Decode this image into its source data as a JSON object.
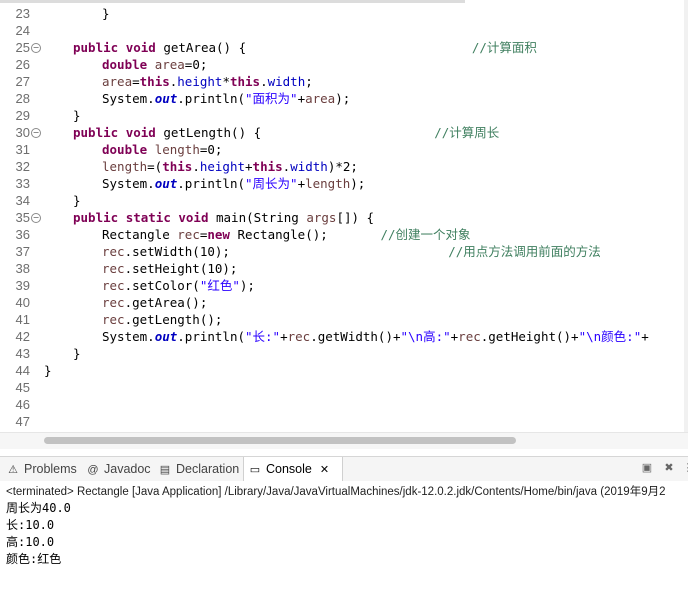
{
  "editor": {
    "lines": [
      {
        "n": "23",
        "fold": false,
        "indent": 2,
        "tokens": [
          [
            "",
            "}"
          ]
        ]
      },
      {
        "n": "24",
        "fold": false,
        "indent": 0,
        "tokens": []
      },
      {
        "n": "25",
        "fold": true,
        "indent": 1,
        "tokens": [
          [
            "kw",
            "public"
          ],
          [
            "",
            " "
          ],
          [
            "kw",
            "void"
          ],
          [
            "",
            " getArea() {                              "
          ],
          [
            "cm",
            "//计算面积"
          ]
        ]
      },
      {
        "n": "26",
        "fold": false,
        "indent": 2,
        "tokens": [
          [
            "kw",
            "double"
          ],
          [
            "",
            " "
          ],
          [
            "lv",
            "area"
          ],
          [
            "",
            "=0;"
          ]
        ]
      },
      {
        "n": "27",
        "fold": false,
        "indent": 2,
        "tokens": [
          [
            "lv",
            "area"
          ],
          [
            "",
            "="
          ],
          [
            "kw",
            "this"
          ],
          [
            "",
            "."
          ],
          [
            "fd",
            "height"
          ],
          [
            "",
            "*"
          ],
          [
            "kw",
            "this"
          ],
          [
            "",
            "."
          ],
          [
            "fd",
            "width"
          ],
          [
            "",
            ";"
          ]
        ]
      },
      {
        "n": "28",
        "fold": false,
        "indent": 2,
        "tokens": [
          [
            "",
            "System."
          ],
          [
            "sf",
            "out"
          ],
          [
            "",
            ".println("
          ],
          [
            "st",
            "\"面积为\""
          ],
          [
            "",
            "+"
          ],
          [
            "lv",
            "area"
          ],
          [
            "",
            ");"
          ]
        ]
      },
      {
        "n": "29",
        "fold": false,
        "indent": 1,
        "tokens": [
          [
            "",
            "}"
          ]
        ]
      },
      {
        "n": "30",
        "fold": true,
        "indent": 1,
        "tokens": [
          [
            "kw",
            "public"
          ],
          [
            "",
            " "
          ],
          [
            "kw",
            "void"
          ],
          [
            "",
            " getLength() {                       "
          ],
          [
            "cm",
            "//计算周长"
          ]
        ]
      },
      {
        "n": "31",
        "fold": false,
        "indent": 2,
        "tokens": [
          [
            "kw",
            "double"
          ],
          [
            "",
            " "
          ],
          [
            "lv",
            "length"
          ],
          [
            "",
            "=0;"
          ]
        ]
      },
      {
        "n": "32",
        "fold": false,
        "indent": 2,
        "tokens": [
          [
            "lv",
            "length"
          ],
          [
            "",
            "=("
          ],
          [
            "kw",
            "this"
          ],
          [
            "",
            "."
          ],
          [
            "fd",
            "height"
          ],
          [
            "",
            "+"
          ],
          [
            "kw",
            "this"
          ],
          [
            "",
            "."
          ],
          [
            "fd",
            "width"
          ],
          [
            "",
            ")*2;"
          ]
        ]
      },
      {
        "n": "33",
        "fold": false,
        "indent": 2,
        "tokens": [
          [
            "",
            "System."
          ],
          [
            "sf",
            "out"
          ],
          [
            "",
            ".println("
          ],
          [
            "st",
            "\"周长为\""
          ],
          [
            "",
            "+"
          ],
          [
            "lv",
            "length"
          ],
          [
            "",
            ");"
          ]
        ]
      },
      {
        "n": "34",
        "fold": false,
        "indent": 1,
        "tokens": [
          [
            "",
            "}"
          ]
        ]
      },
      {
        "n": "35",
        "fold": true,
        "indent": 1,
        "tokens": [
          [
            "kw",
            "public"
          ],
          [
            "",
            " "
          ],
          [
            "kw",
            "static"
          ],
          [
            "",
            " "
          ],
          [
            "kw",
            "void"
          ],
          [
            "",
            " main(String "
          ],
          [
            "lv",
            "args"
          ],
          [
            "",
            "[]) {"
          ]
        ]
      },
      {
        "n": "36",
        "fold": false,
        "indent": 2,
        "tokens": [
          [
            "",
            "Rectangle "
          ],
          [
            "lv",
            "rec"
          ],
          [
            "",
            "="
          ],
          [
            "kw",
            "new"
          ],
          [
            "",
            " Rectangle();       "
          ],
          [
            "cm",
            "//创建一个对象"
          ]
        ]
      },
      {
        "n": "37",
        "fold": false,
        "indent": 2,
        "tokens": [
          [
            "lv",
            "rec"
          ],
          [
            "",
            ".setWidth(10);                             "
          ],
          [
            "cm",
            "//用点方法调用前面的方法"
          ]
        ]
      },
      {
        "n": "38",
        "fold": false,
        "indent": 2,
        "tokens": [
          [
            "lv",
            "rec"
          ],
          [
            "",
            ".setHeight(10);"
          ]
        ]
      },
      {
        "n": "39",
        "fold": false,
        "indent": 2,
        "tokens": [
          [
            "lv",
            "rec"
          ],
          [
            "",
            ".setColor("
          ],
          [
            "st",
            "\"红色\""
          ],
          [
            "",
            ");"
          ]
        ]
      },
      {
        "n": "40",
        "fold": false,
        "indent": 2,
        "tokens": [
          [
            "lv",
            "rec"
          ],
          [
            "",
            ".getArea();"
          ]
        ]
      },
      {
        "n": "41",
        "fold": false,
        "indent": 2,
        "tokens": [
          [
            "lv",
            "rec"
          ],
          [
            "",
            ".getLength();"
          ]
        ]
      },
      {
        "n": "42",
        "fold": false,
        "indent": 2,
        "tokens": [
          [
            "",
            "System."
          ],
          [
            "sf",
            "out"
          ],
          [
            "",
            ".println("
          ],
          [
            "st",
            "\"长:\""
          ],
          [
            "",
            "+"
          ],
          [
            "lv",
            "rec"
          ],
          [
            "",
            ".getWidth()+"
          ],
          [
            "st",
            "\"\\n高:\""
          ],
          [
            "",
            "+"
          ],
          [
            "lv",
            "rec"
          ],
          [
            "",
            ".getHeight()+"
          ],
          [
            "st",
            "\"\\n颜色:\""
          ],
          [
            "",
            "+"
          ]
        ]
      },
      {
        "n": "43",
        "fold": false,
        "indent": 1,
        "tokens": [
          [
            "",
            "}"
          ]
        ]
      },
      {
        "n": "44",
        "fold": false,
        "indent": 0,
        "tokens": [
          [
            "",
            "}"
          ]
        ]
      },
      {
        "n": "45",
        "fold": false,
        "indent": 0,
        "tokens": []
      },
      {
        "n": "46",
        "fold": false,
        "indent": 0,
        "tokens": []
      },
      {
        "n": "47",
        "fold": false,
        "indent": 0,
        "tokens": []
      }
    ]
  },
  "panel": {
    "tabs": [
      {
        "name": "problems",
        "label": "Problems",
        "icon": "problems-icon",
        "glyph": "⚠",
        "active": false
      },
      {
        "name": "javadoc",
        "label": "Javadoc",
        "icon": "javadoc-icon",
        "glyph": "@",
        "active": false
      },
      {
        "name": "declaration",
        "label": "Declaration",
        "icon": "declaration-icon",
        "glyph": "▤",
        "active": false
      },
      {
        "name": "console",
        "label": "Console",
        "icon": "console-icon",
        "glyph": "▭",
        "active": true
      }
    ],
    "close_glyph": "✕"
  },
  "console": {
    "terminated": "<terminated> Rectangle [Java Application] /Library/Java/JavaVirtualMachines/jdk-12.0.2.jdk/Contents/Home/bin/java (2019年9月2",
    "output": [
      "周长为40.0",
      "长:10.0",
      "高:10.0",
      "颜色:红色"
    ]
  }
}
